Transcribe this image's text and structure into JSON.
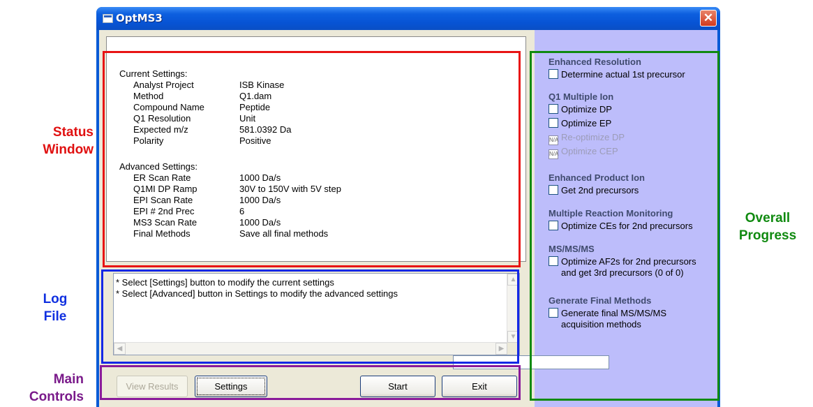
{
  "window": {
    "title": "OptMS3",
    "close_icon": "close-icon"
  },
  "callouts": {
    "status": [
      "Status",
      "Window"
    ],
    "log": [
      "Log",
      "File"
    ],
    "main": [
      "Main",
      "Controls"
    ],
    "progress": [
      "Overall",
      "Progress"
    ]
  },
  "status": {
    "current_header": "Current Settings:",
    "current": [
      {
        "label": "Analyst Project",
        "value": "ISB Kinase"
      },
      {
        "label": "Method",
        "value": "Q1.dam"
      },
      {
        "label": "Compound Name",
        "value": "Peptide"
      },
      {
        "label": "Q1 Resolution",
        "value": "Unit"
      },
      {
        "label": "Expected m/z",
        "value": "581.0392 Da"
      },
      {
        "label": "Polarity",
        "value": "Positive"
      }
    ],
    "advanced_header": "Advanced Settings:",
    "advanced": [
      {
        "label": "ER Scan Rate",
        "value": "1000 Da/s"
      },
      {
        "label": "Q1MI DP Ramp",
        "value": "30V to 150V with 5V step"
      },
      {
        "label": "EPI Scan Rate",
        "value": "1000 Da/s"
      },
      {
        "label": "EPI # 2nd Prec",
        "value": "6"
      },
      {
        "label": "MS3 Scan Rate",
        "value": "1000 Da/s"
      },
      {
        "label": "Final Methods",
        "value": "Save all final methods"
      }
    ]
  },
  "log": {
    "lines": [
      "* Select [Settings] button to modify the current settings",
      "* Select [Advanced] button in Settings to modify the advanced settings"
    ]
  },
  "controls": {
    "view_results": "View Results",
    "settings": "Settings",
    "start": "Start",
    "exit": "Exit"
  },
  "progress": {
    "enhanced_resolution": "Enhanced Resolution",
    "determine_precursor": "Determine actual 1st precursor",
    "q1_multiple_ion": "Q1 Multiple Ion",
    "optimize_dp": "Optimize DP",
    "optimize_ep": "Optimize EP",
    "reoptimize_dp": "Re-optimize DP",
    "optimize_cep": "Optimize CEP",
    "enhanced_product_ion": "Enhanced Product Ion",
    "get_2nd_precursors": "Get 2nd precursors",
    "mrm": "Multiple Reaction Monitoring",
    "optimize_ces": "Optimize CEs for 2nd precursors",
    "msmsms": "MS/MS/MS",
    "optimize_af2s": "Optimize AF2s for 2nd precursors",
    "optimize_af2s_cont": "and get 3rd precursors (0 of 0)",
    "generate_final": "Generate Final Methods",
    "generate_final_ms": "Generate final MS/MS/MS",
    "generate_final_ms_cont": "acquisition methods",
    "na_glyph": "N/A"
  },
  "colors": {
    "status_frame": "#e81414",
    "log_frame": "#1428e6",
    "controls_frame": "#8a1a9a",
    "progress_frame": "#108a10"
  }
}
